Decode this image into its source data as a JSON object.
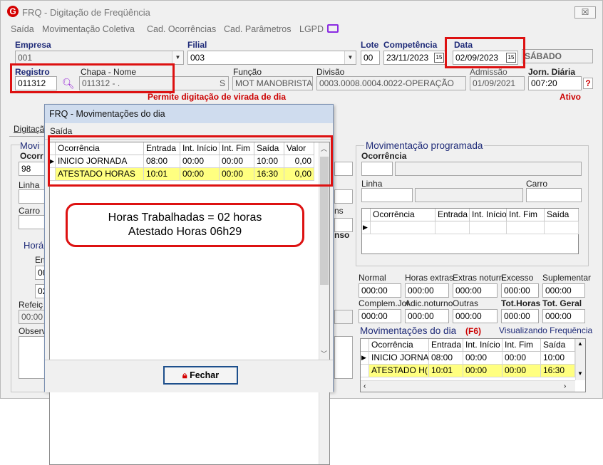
{
  "window": {
    "title": "FRQ - Digitação de Freqüência",
    "logo": "G",
    "close_label": "☒"
  },
  "menu": [
    "Saída",
    "Movimentação Coletiva",
    "Cad. Ocorrências",
    "Cad. Parâmetros",
    "LGPD"
  ],
  "fields": {
    "empresa_label": "Empresa",
    "empresa_value": "001",
    "filial_label": "Filial",
    "filial_value": "003",
    "lote_label": "Lote",
    "lote_value": "00",
    "competencia_label": "Competência",
    "competencia_value": "23/11/2023",
    "data_label": "Data",
    "data_value": "02/09/2023",
    "weekday": "SÁBADO",
    "registro_label": "Registro",
    "registro_value": "011312",
    "chapa_label": "Chapa  -  Nome",
    "chapa_value": "011312 - .",
    "chapa_suffix": "S",
    "funcao_label": "Função",
    "funcao_value": "MOT MANOBRISTA",
    "divisao_label": "Divisão",
    "divisao_value": "0003.0008.0004.0022-OPERAÇÃO",
    "admissao_label": "Admissão",
    "admissao_value": "01/09/2021",
    "jorn_label": "Jorn. Diária",
    "jorn_value": "007:20",
    "help": "?",
    "virada_text": "Permite digitação de virada de dia",
    "status": "Ativo",
    "cal_icon": "15"
  },
  "left_panel": {
    "tab": "Digitação",
    "mov_label": "Movi",
    "ocor_label": "Ocorr",
    "ocor_value": "98",
    "linha": "Linha",
    "carro": "Carro",
    "horas_label": "Horá",
    "en": "En",
    "en_val": "00",
    "val02": "02",
    "refeicao": "Refeiç",
    "ref_val": "00:00",
    "observ": "Observ"
  },
  "dialog": {
    "title": "FRQ - Movimentações do dia",
    "menu": "Saída",
    "columns": [
      "Ocorrência",
      "Entrada",
      "Int. Início",
      "Int. Fim",
      "Saída",
      "Valor"
    ],
    "rows": [
      [
        "INICIO JORNADA",
        "08:00",
        "00:00",
        "00:00",
        "10:00",
        "0,00"
      ],
      [
        "ATESTADO HORAS",
        "10:01",
        "00:00",
        "00:00",
        "16:30",
        "0,00"
      ]
    ],
    "button": "Fechar"
  },
  "callout": {
    "line1": "Horas Trabalhadas = 02 horas",
    "line2": "Atestado Horas 06h29"
  },
  "right_panel": {
    "title": "Movimentação programada",
    "ocorrencia": "Ocorrência",
    "linha": "Linha",
    "carro": "Carro",
    "side_ns": "ns",
    "side_nso": "nso",
    "grid_cols": [
      "Ocorrência",
      "Entrada",
      "Int. Início",
      "Int. Fim",
      "Saída"
    ],
    "totals_row1_labels": [
      "Normal",
      "Horas extras",
      "Extras noturn.",
      "Excesso",
      "Suplementar"
    ],
    "totals_row1_values": [
      "000:00",
      "000:00",
      "000:00",
      "000:00",
      "000:00"
    ],
    "totals_row2_labels": [
      "Complem.Jor.",
      "Adic.noturno",
      "Outras",
      "Tot.Horas",
      "Tot. Geral"
    ],
    "totals_row2_values": [
      "000:00",
      "000:00",
      "000:00",
      "000:00",
      "000:00"
    ],
    "mov_dia": "Movimentações do dia",
    "f6": "(F6)",
    "visualizando": "Visualizando Frequência",
    "mov_cols": [
      "Ocorrência",
      "Entrada",
      "Int. Início",
      "Int. Fim",
      "Saída"
    ],
    "mov_rows": [
      [
        "INICIO JORNA",
        "08:00",
        "00:00",
        "00:00",
        "10:00"
      ],
      [
        "ATESTADO H(",
        "10:01",
        "00:00",
        "00:00",
        "16:30"
      ]
    ]
  }
}
